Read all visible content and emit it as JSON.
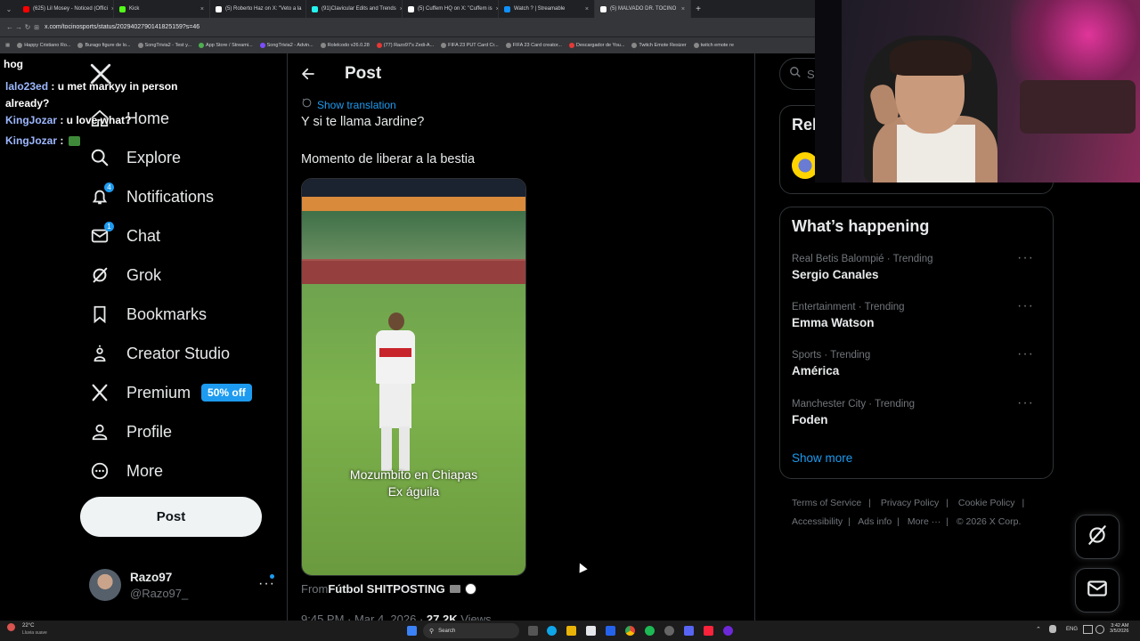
{
  "browser": {
    "tabs": [
      {
        "title": "(625) Lil Mosey - Noticed (Offici"
      },
      {
        "title": "Kick"
      },
      {
        "title": "(5) Roberto Haz on X: \"Veto a la"
      },
      {
        "title": "(91)Clavicular Edits and Trends"
      },
      {
        "title": "(5) Cuffem HQ on X: \"Cuffem is"
      },
      {
        "title": "Watch ? | Streamable"
      },
      {
        "title": "(5) MALVADO DR. TOCINO"
      }
    ],
    "new_tab": "+",
    "url": "x.com/tocinosports/status/2029402790141825159?s=46",
    "bookmarks": [
      "Happy Cristiano Ro...",
      "Burago figure de lo...",
      "SongTrivia2 - Test y...",
      "App Store / Streami...",
      "SongTrivia2 - Advin...",
      "Rolelcodo v26.0.28",
      "(77) Razo97's Zedi-A...",
      "FIFA 23 PUT Card Cr...",
      "FIFA 23 Card creator...",
      "Descargador de You...",
      "Twitch Emote Resizer",
      "twitch emote re"
    ]
  },
  "chat": [
    {
      "user": "",
      "text": "hog"
    },
    {
      "user": "lalo23ed",
      "text": " : u met markyy in person already?"
    },
    {
      "user": "KingJozar",
      "text": " : u love what?"
    },
    {
      "user": "KingJozar",
      "text": " : "
    }
  ],
  "sidebar": {
    "items": [
      {
        "label": "Home",
        "icon": "home-icon",
        "badge": ""
      },
      {
        "label": "Explore",
        "icon": "search-icon",
        "badge": ""
      },
      {
        "label": "Notifications",
        "icon": "bell-icon",
        "badge": "4"
      },
      {
        "label": "Chat",
        "icon": "mail-icon",
        "badge": "1"
      },
      {
        "label": "Grok",
        "icon": "grok-icon",
        "badge": ""
      },
      {
        "label": "Bookmarks",
        "icon": "bookmark-icon",
        "badge": ""
      },
      {
        "label": "Creator Studio",
        "icon": "creator-icon",
        "badge": ""
      },
      {
        "label": "Premium",
        "icon": "x-logo-icon",
        "badge": ""
      },
      {
        "label": "Profile",
        "icon": "person-icon",
        "badge": ""
      },
      {
        "label": "More",
        "icon": "more-circle-icon",
        "badge": ""
      }
    ],
    "premium_pill": "50% off",
    "post_button": "Post",
    "account": {
      "name": "Razo97",
      "handle": "@Razo97_"
    }
  },
  "main": {
    "header": "Post",
    "show_translation": "Show translation",
    "text_line1": "Y si te llama Jardine?",
    "text_line2": "Momento de liberar a la bestia",
    "video_caption_line1": "Mozumbito en Chiapas",
    "video_caption_line2": "Ex águila",
    "from_prefix": "From ",
    "from_source": "Fútbol SHITPOSTING",
    "meta_time": "9:45 PM · Mar 4, 2026 · ",
    "meta_views_count": "27.2K",
    "meta_views_label": " Views"
  },
  "right": {
    "search_placeholder": "Se",
    "relevant_title": "Rel",
    "whats_happening": "What’s happening",
    "trends": [
      {
        "meta": "Real Betis Balompié · Trending",
        "name": "Sergio Canales"
      },
      {
        "meta": "Entertainment · Trending",
        "name": "Emma Watson"
      },
      {
        "meta": "Sports · Trending",
        "name": "América"
      },
      {
        "meta": "Manchester City · Trending",
        "name": "Foden"
      }
    ],
    "show_more": "Show more",
    "footer_row1": [
      "Terms of Service",
      "Privacy Policy",
      "Cookie Policy"
    ],
    "footer_row2": [
      "Accessibility",
      "Ads info",
      "More ···",
      "© 2026 X Corp."
    ]
  },
  "taskbar": {
    "weather_temp": "22°C",
    "weather_desc": "Lluvia suave",
    "search": "Search",
    "lang": "ENG",
    "time": "3:42 AM",
    "date": "3/5/2026"
  },
  "colors": {
    "accent": "#1d9bf0",
    "bg": "#000000",
    "text": "#e7e9ea",
    "muted": "#71767b"
  }
}
